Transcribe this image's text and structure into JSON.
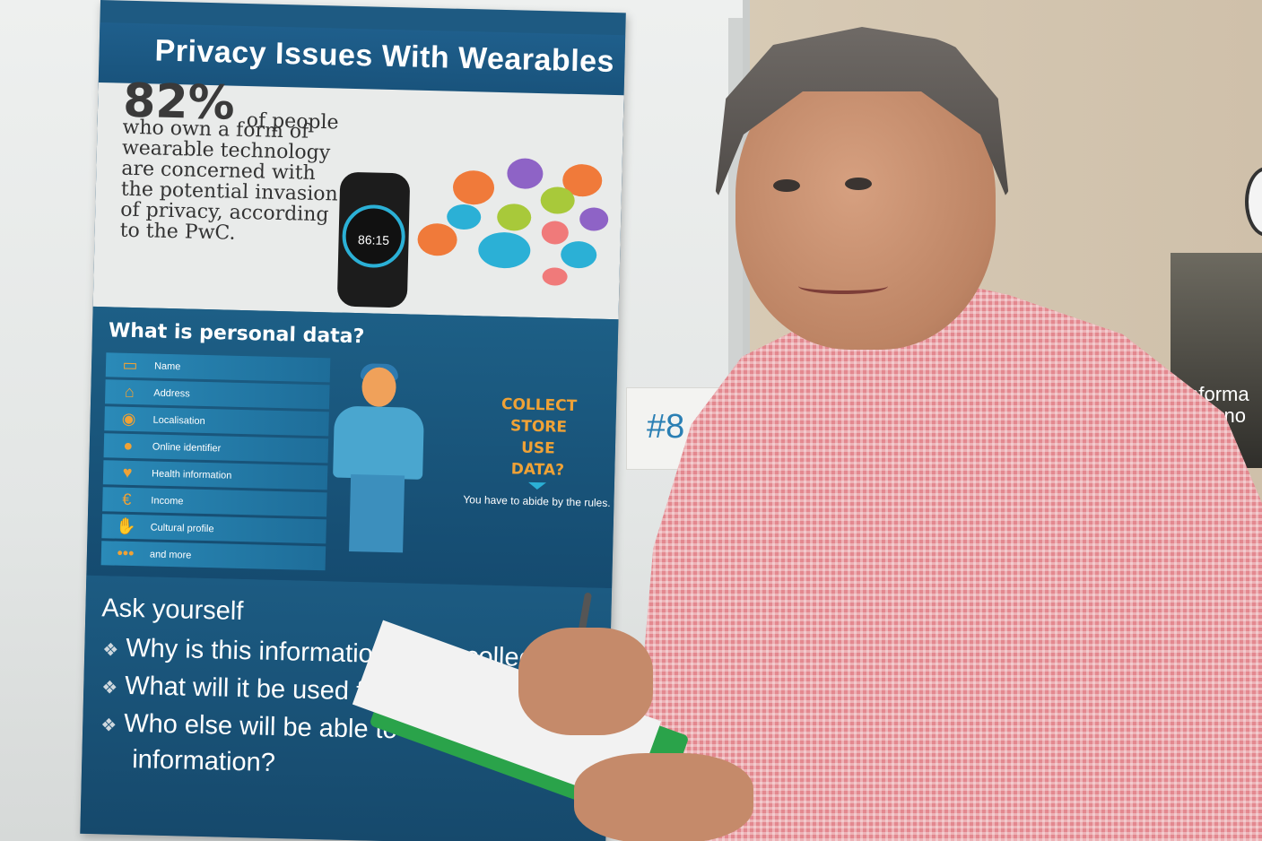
{
  "poster": {
    "title": "Privacy Issues With Wearables",
    "stat_number": "82%",
    "stat_lead": "of people",
    "stat_text": "who own a form of wearable technology are concerned with the potential invasion of privacy, according to the PwC.",
    "watch_time": "86:15",
    "personal_data_title": "What is personal data?",
    "personal_data_items": [
      {
        "icon": "id-card-icon",
        "glyph": "▭",
        "label": "Name"
      },
      {
        "icon": "house-icon",
        "glyph": "⌂",
        "label": "Address"
      },
      {
        "icon": "location-pin-icon",
        "glyph": "◉",
        "label": "Localisation"
      },
      {
        "icon": "person-icon",
        "glyph": "●",
        "label": "Online identifier"
      },
      {
        "icon": "heart-pulse-icon",
        "glyph": "♥",
        "label": "Health information"
      },
      {
        "icon": "euro-icon",
        "glyph": "€",
        "label": "Income"
      },
      {
        "icon": "hands-icon",
        "glyph": "✋",
        "label": "Cultural profile"
      },
      {
        "icon": "dots-icon",
        "glyph": "•••",
        "label": "and more"
      }
    ],
    "collect_lines": [
      "COLLECT",
      "STORE",
      "USE",
      "DATA?"
    ],
    "rules_text": "You have to abide by the rules.",
    "ask_title": "Ask yourself",
    "ask_items": [
      "Why is this information being collected?",
      "What will it be used for?",
      "Who else will be able to access",
      "information?"
    ]
  },
  "tag": {
    "label": "#8"
  },
  "banner": {
    "line1": "Informa",
    "line2": "Techno"
  },
  "colors": {
    "poster_blue": "#1e5a82",
    "accent_orange": "#f0a236",
    "accent_cyan": "#2bb0d6",
    "shirt": "#e3888f"
  }
}
